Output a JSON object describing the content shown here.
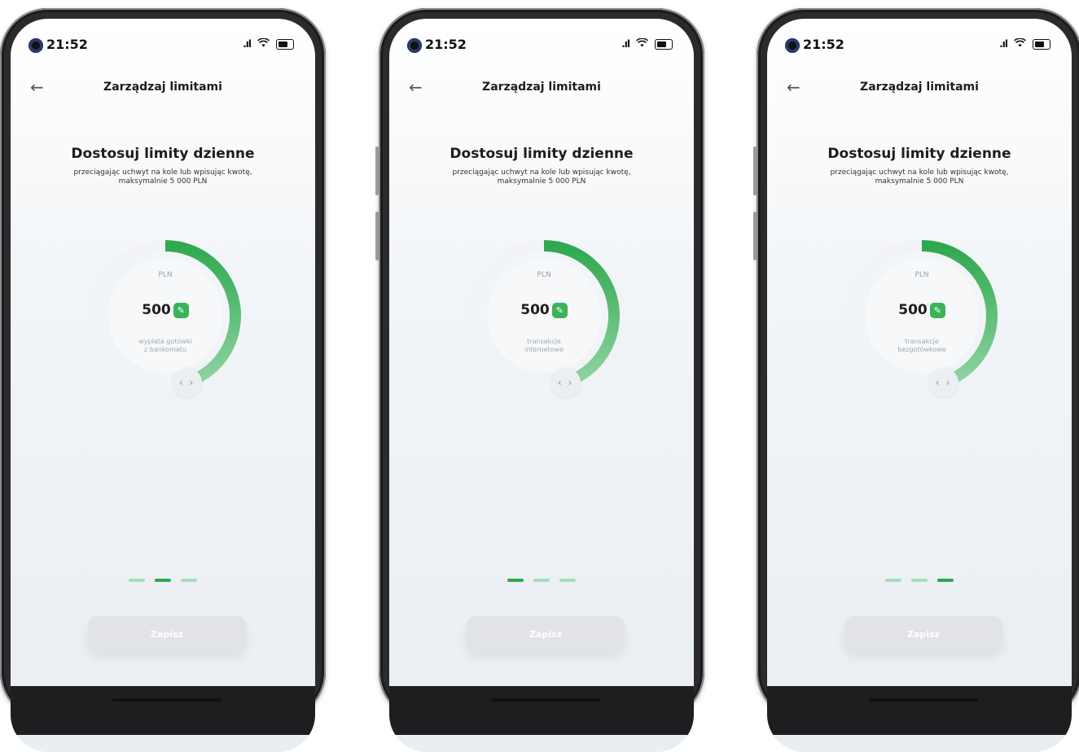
{
  "screens": [
    {
      "status": {
        "time": "21:52"
      },
      "nav": {
        "title": "Zarządzaj limitami"
      },
      "heading": "Dostosuj limity dzienne",
      "subtext_line1": "przeciągając uchwyt na kole lub wpisując kwotę,",
      "subtext_line2": "maksymalnie 5 000 PLN",
      "dial": {
        "currency": "PLN",
        "amount": "500",
        "category_line1": "wypłata gotówki",
        "category_line2": "z bankomatu",
        "fill_fraction": 0.45
      },
      "pagination": {
        "count": 3,
        "active_index": 1
      },
      "save_label": "Zapisz"
    },
    {
      "status": {
        "time": "21:52"
      },
      "nav": {
        "title": "Zarządzaj limitami"
      },
      "heading": "Dostosuj limity dzienne",
      "subtext_line1": "przeciągając uchwyt na kole lub wpisując kwotę,",
      "subtext_line2": "maksymalnie 5 000 PLN",
      "dial": {
        "currency": "PLN",
        "amount": "500",
        "category_line1": "transakcje",
        "category_line2": "internetowe",
        "fill_fraction": 0.45
      },
      "pagination": {
        "count": 3,
        "active_index": 0
      },
      "save_label": "Zapisz"
    },
    {
      "status": {
        "time": "21:52"
      },
      "nav": {
        "title": "Zarządzaj limitami"
      },
      "heading": "Dostosuj limity dzienne",
      "subtext_line1": "przeciągając uchwyt na kole lub wpisując kwotę,",
      "subtext_line2": "maksymalnie 5 000 PLN",
      "dial": {
        "currency": "PLN",
        "amount": "500",
        "category_line1": "transakcje",
        "category_line2": "bezgotówkowe",
        "fill_fraction": 0.45
      },
      "pagination": {
        "count": 3,
        "active_index": 2
      },
      "save_label": "Zapisz"
    }
  ],
  "colors": {
    "accent": "#2fa84f",
    "accent_light": "#a8dcb8",
    "ring_track": "#f1f3f5",
    "button_disabled": "#e1e3e6",
    "text_primary": "#1d1d1f",
    "text_muted": "#9aa0a6"
  },
  "icons": {
    "back": "arrow-left-icon",
    "edit": "pencil-icon",
    "handle": "drag-handle-icon",
    "wifi": "wifi-icon",
    "signal": "signal-icon",
    "battery": "battery-icon"
  }
}
